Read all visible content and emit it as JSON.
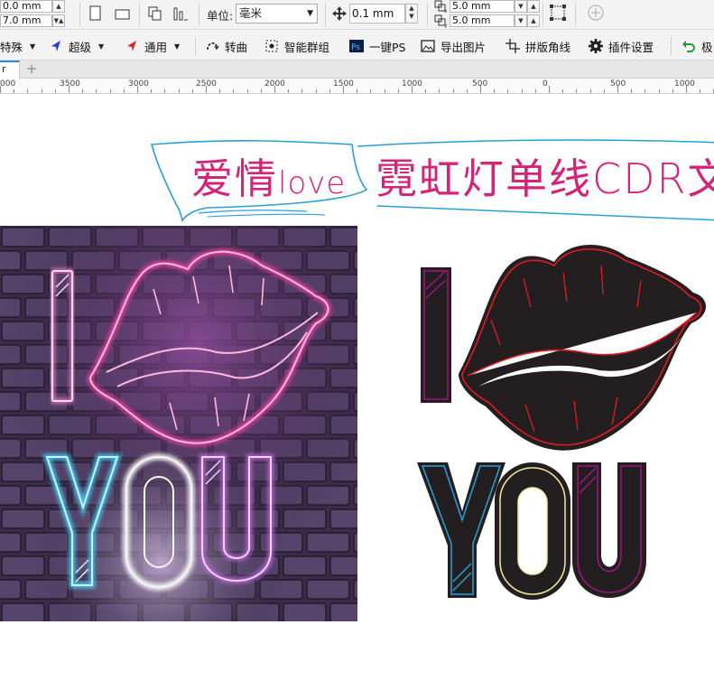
{
  "toolbar": {
    "size_x": "0.0 mm",
    "size_y": "7.0 mm",
    "unit_label": "单位:",
    "unit_value": "毫米",
    "nudge_value": "0.1 mm",
    "dup_x": "5.0 mm",
    "dup_y": "5.0 mm"
  },
  "plugin_bar": {
    "items": [
      {
        "label": "特殊",
        "icon": "magic-pen-icon"
      },
      {
        "label": "超级",
        "icon": "blue-arrow-icon"
      },
      {
        "label": "通用",
        "icon": "red-arrow-icon"
      },
      {
        "label": "转曲",
        "icon": "convert-curve-icon"
      },
      {
        "label": "智能群组",
        "icon": "smart-group-icon"
      },
      {
        "label": "一键PS",
        "icon": "photoshop-icon"
      },
      {
        "label": "导出图片",
        "icon": "image-icon"
      },
      {
        "label": "拼版角线",
        "icon": "crop-marks-icon"
      },
      {
        "label": "插件设置",
        "icon": "gear-icon"
      },
      {
        "label": "极",
        "icon": "undo-icon"
      }
    ],
    "ps_badge": "Ps"
  },
  "tabs": {
    "active_tab": "r",
    "add_symbol": "+"
  },
  "ruler": {
    "labels": [
      "000",
      "3500",
      "3000",
      "2500",
      "2000",
      "1500",
      "1000",
      "500",
      "0",
      "500",
      "1000"
    ]
  },
  "artwork": {
    "title_chars": "爱情",
    "title_latin": "love",
    "title_rest": "霓虹灯单线CDR文",
    "letter_i": "I",
    "word_you": "YOU"
  },
  "colors": {
    "neon_pink": "#ff3fa4",
    "neon_cyan": "#3fd6ff",
    "title_magenta": "#d4237a",
    "callout_blue": "#2a9fd6",
    "lips_red": "#e01a24",
    "letter_dark": "#231f20"
  }
}
